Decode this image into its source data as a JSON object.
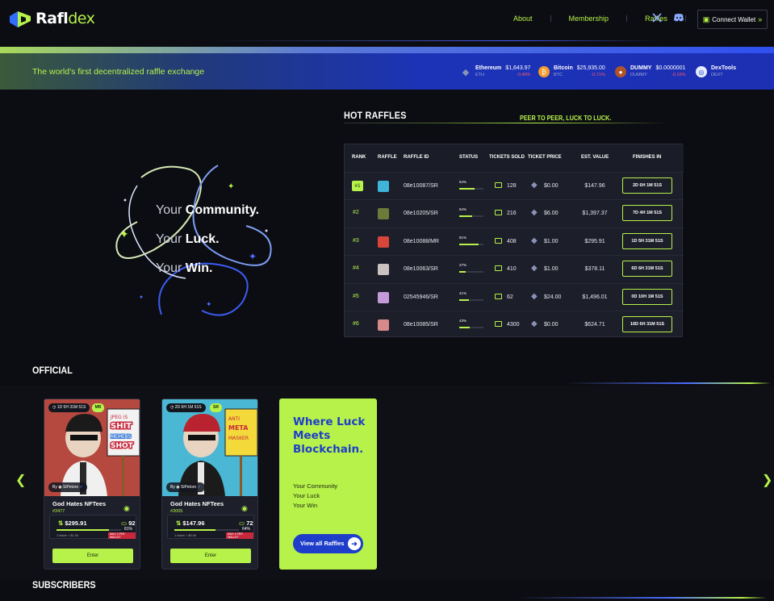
{
  "brand": {
    "name_part1": "Rafl",
    "name_part2": "dex"
  },
  "nav": {
    "links": [
      "About",
      "Membership",
      "Raffles"
    ],
    "connect_label": "Connect Wallet"
  },
  "ticker": {
    "tagline": "The world's first decentralized raffle exchange",
    "coins": [
      {
        "name": "Ethereum",
        "symbol": "ETH",
        "price": "$1,643.97",
        "change": "-0.49%",
        "color": "#6f7dbb",
        "icon": "◆"
      },
      {
        "name": "Bitcoin",
        "symbol": "BTC",
        "price": "$25,935.00",
        "change": "-0.71%",
        "color": "#f29b2c",
        "icon": "₿"
      },
      {
        "name": "DUMMY",
        "symbol": "DUMMY",
        "price": "$0.0000001",
        "change": "-0.16%",
        "color": "#b0552a",
        "icon": "●"
      },
      {
        "name": "DexTools",
        "symbol": "DEXT",
        "price": "",
        "change": "",
        "color": "#e7ecff",
        "icon": "◎"
      }
    ]
  },
  "hero": {
    "lines": [
      [
        "Your ",
        "Community."
      ],
      [
        "Your ",
        "Luck."
      ],
      [
        "Your ",
        "Win."
      ]
    ]
  },
  "hot": {
    "title": "HOT RAFFLES",
    "slogan": "PEER TO PEER, LUCK TO LUCK.",
    "headers": [
      "RANK",
      "RAFFLE",
      "RAFFLE ID",
      "STATUS",
      "TICKETS SOLD",
      "TICKET PRICE",
      "EST. VALUE",
      "FINISHES IN"
    ],
    "rows": [
      {
        "rank": "#1",
        "id": "08e10087/SR",
        "status_pct": "64%",
        "status": 0.64,
        "tickets": "128",
        "price": "$0.00",
        "value": "$147.96",
        "finishes": "2D 6H 1M 51S",
        "thumb": "#3fb4d8"
      },
      {
        "rank": "#2",
        "id": "08e10205/SR",
        "status_pct": "54%",
        "status": 0.54,
        "tickets": "216",
        "price": "$6.00",
        "value": "$1,397.37",
        "finishes": "7D 4H 1M 51S",
        "thumb": "#6c7a3a"
      },
      {
        "rank": "#3",
        "id": "08e10088/MR",
        "status_pct": "81%",
        "status": 0.81,
        "tickets": "408",
        "price": "$1.00",
        "value": "$295.91",
        "finishes": "1D 5H 31M 51S",
        "thumb": "#d8453b"
      },
      {
        "rank": "#4",
        "id": "08e10063/SR",
        "status_pct": "27%",
        "status": 0.27,
        "tickets": "410",
        "price": "$1.00",
        "value": "$378.11",
        "finishes": "6D 6H 31M 51S",
        "thumb": "#c9c3c0"
      },
      {
        "rank": "#5",
        "id": "02545946/SR",
        "status_pct": "41%",
        "status": 0.41,
        "tickets": "62",
        "price": "$24.00",
        "value": "$1,496.01",
        "finishes": "0D 10H 1M 51S",
        "thumb": "#c59ad8"
      },
      {
        "rank": "#6",
        "id": "08e10085/SR",
        "status_pct": "43%",
        "status": 0.43,
        "tickets": "4300",
        "price": "$0.00",
        "value": "$624.71",
        "finishes": "16D 6H 31M 51S",
        "thumb": "#d88a8a"
      }
    ]
  },
  "official": {
    "title": "OFFICIAL",
    "cards": [
      {
        "timer": "1D 5H 31M 51S",
        "badge": "MR",
        "by": "By",
        "creator": "SiPetoro",
        "title": "God Hates NFTees",
        "id": "#3477",
        "price": "$295.91",
        "tickets": "92",
        "pct": "81%",
        "fill": 0.81,
        "foot": "1 ticket = $1.00",
        "max": "MAX 1 PER WALLET",
        "enter": "Enter",
        "bg": "#b5483f",
        "sign1": "JPEG IS",
        "sign2": "SHIT",
        "sign3": "MEME IS",
        "sign4": "SHOT"
      },
      {
        "timer": "2D 6H 1M 51S",
        "badge": "SR",
        "by": "By",
        "creator": "SiPetoro",
        "title": "God Hates NFTees",
        "id": "#3005",
        "price": "$147.96",
        "tickets": "72",
        "pct": "64%",
        "fill": 0.64,
        "foot": "1 ticket = $0.00",
        "max": "MAX 1 PER WALLET",
        "enter": "Enter",
        "bg": "#4ab8d4",
        "sign1": "ANTI",
        "sign2": "META",
        "sign3": "MASKER",
        "sign4": ""
      }
    ],
    "promo": {
      "heading": "Where Luck Meets Blockchain.",
      "lines": [
        "Your Community",
        "Your Luck",
        "Your Win"
      ],
      "button": "View all Raffles"
    }
  },
  "subscribers": {
    "title": "SUBSCRIBERS"
  },
  "colors": {
    "accent": "#b7f24a",
    "brand_blue": "#1e3ec9",
    "bg": "#0c0d12"
  }
}
